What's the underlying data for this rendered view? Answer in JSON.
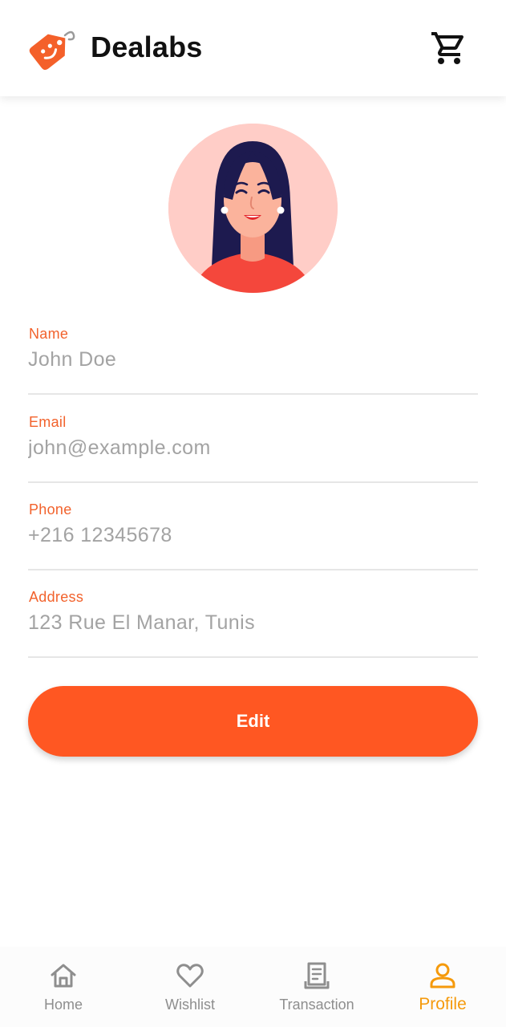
{
  "header": {
    "app_name": "Dealabs",
    "logo_icon": "price-tag-smile-icon",
    "cart_icon": "shopping-cart-icon"
  },
  "profile": {
    "avatar_icon": "woman-avatar-illustration",
    "fields": [
      {
        "label": "Name",
        "value": "John Doe"
      },
      {
        "label": "Email",
        "value": "john@example.com"
      },
      {
        "label": "Phone",
        "value": "+216 12345678"
      },
      {
        "label": "Address",
        "value": "123 Rue El Manar, Tunis"
      }
    ],
    "edit_label": "Edit"
  },
  "nav": {
    "items": [
      {
        "label": "Home",
        "icon": "home-icon",
        "active": false
      },
      {
        "label": "Wishlist",
        "icon": "heart-icon",
        "active": false
      },
      {
        "label": "Transaction",
        "icon": "receipt-icon",
        "active": false
      },
      {
        "label": "Profile",
        "icon": "person-icon",
        "active": true
      }
    ]
  },
  "colors": {
    "accent": "#ff5722",
    "label": "#f2622c",
    "nav_active": "#f59a0c",
    "nav_inactive": "#8e8e8e",
    "value_text": "#a3a3a3"
  }
}
